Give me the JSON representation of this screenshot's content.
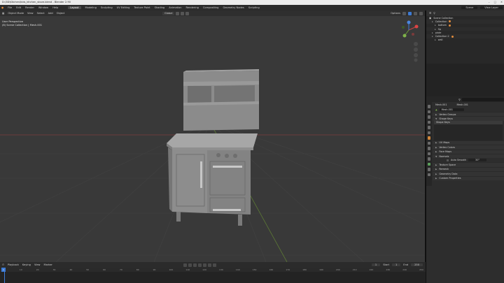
{
  "window": {
    "title": "D:\\3D\\Kitchen\\kids_kitchen_stove.blend - Blender 2.90"
  },
  "menubar": {
    "items": [
      "File",
      "Edit",
      "Render",
      "Window",
      "Help"
    ],
    "workspaces": [
      "Layout",
      "Modeling",
      "Sculpting",
      "UV Editing",
      "Texture Paint",
      "Shading",
      "Animation",
      "Rendering",
      "Compositing",
      "Geometry Nodes",
      "Scripting"
    ],
    "active_workspace": "Layout",
    "scene_label": "Scene",
    "view_layer_label": "View Layer"
  },
  "viewport": {
    "mode": "Object Mode",
    "menus": [
      "View",
      "Select",
      "Add",
      "Object"
    ],
    "transform_orientation": "Global",
    "options_label": "Options",
    "info_line1": "User Perspective",
    "info_line2": "(8) Scene Collection | Mesh.001"
  },
  "outliner": {
    "title": "Scene Collection",
    "rows": [
      {
        "label": "Collection",
        "indent": 1
      },
      {
        "label": "bottom",
        "indent": 2
      },
      {
        "label": "Sp",
        "indent": 2
      },
      {
        "label": "plate",
        "indent": 1
      },
      {
        "label": "Collection 2",
        "indent": 1
      },
      {
        "label": "wall",
        "indent": 2
      }
    ]
  },
  "properties": {
    "breadcrumb_left": "Mesh.001",
    "breadcrumb_right": "Mesh.001",
    "mesh_name": "Mesh.001",
    "panels_top": [
      "Vertex Groups",
      "Shape Keys"
    ],
    "shape_key_item": "Shape Keys",
    "panels_bottom": [
      "UV Maps",
      "Vertex Colors",
      "Face Maps",
      "Normals"
    ],
    "auto_smooth_label": "Auto Smooth",
    "auto_smooth_value": "30°",
    "panels_tail": [
      "Texture Space",
      "Remesh",
      "Geometry Data",
      "Custom Properties"
    ]
  },
  "timeline": {
    "menus": [
      "Playback",
      "Keying",
      "View",
      "Marker"
    ],
    "current_frame": "1",
    "start_label": "Start",
    "start_value": "1",
    "end_label": "End",
    "end_value": "250",
    "ruler": [
      "0",
      "10",
      "20",
      "30",
      "40",
      "50",
      "60",
      "70",
      "80",
      "90",
      "100",
      "110",
      "120",
      "130",
      "140",
      "150",
      "160",
      "170",
      "180",
      "190",
      "200",
      "210",
      "220",
      "230",
      "240",
      "250"
    ]
  },
  "colors": {
    "accent": "#3d7bd6",
    "viewport_bg": "#393939",
    "object_orange": "#e08b3c",
    "model_gray": "#8a8a8a"
  }
}
